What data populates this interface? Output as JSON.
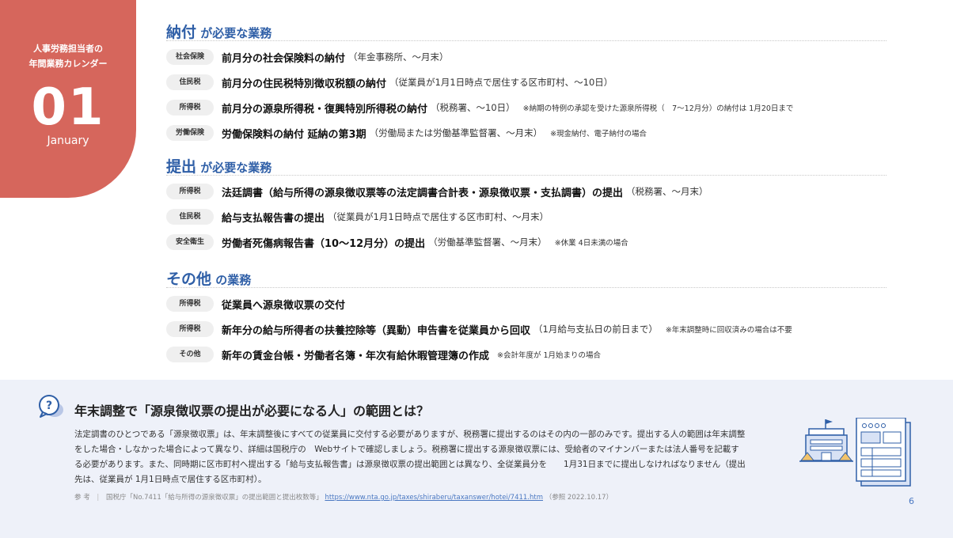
{
  "calendar": {
    "title_line1": "人事労務担当者の",
    "title_line2": "年間業務カレンダー",
    "month_number": "01",
    "month_name": "January"
  },
  "sections": [
    {
      "heading_key": "納付",
      "heading_rest": " が必要な業務",
      "rows": [
        {
          "tag": "社会保険",
          "main": "前月分の社会保険料の納付",
          "sub": "（年金事務所、〜月末）",
          "note": ""
        },
        {
          "tag": "住民税",
          "main": "前月分の住民税特別徴収税額の納付",
          "sub": "（従業員が1月1日時点で居住する区市町村、〜10日）",
          "note": ""
        },
        {
          "tag": "所得税",
          "main": "前月分の源泉所得税・復興特別所得税の納付",
          "sub": "（税務署、〜10日）",
          "note": "※納期の特例の承認を受けた源泉所得税（　7〜12月分）の納付は 1月20日まで"
        },
        {
          "tag": "労働保険",
          "main": "労働保険料の納付 延納の第3期",
          "sub": "（労働局または労働基準監督署、〜月末）",
          "note": "※現金納付、電子納付の場合"
        }
      ]
    },
    {
      "heading_key": "提出",
      "heading_rest": " が必要な業務",
      "rows": [
        {
          "tag": "所得税",
          "main": "法廷調書（給与所得の源泉徴収票等の法定調書合計表・源泉徴収票・支払調書）の提出",
          "sub": "（税務署、〜月末）",
          "note": ""
        },
        {
          "tag": "住民税",
          "main": "給与支払報告書の提出",
          "sub": "（従業員が1月1日時点で居住する区市町村、〜月末）",
          "note": ""
        },
        {
          "tag": "安全衛生",
          "main": "労働者死傷病報告書（10〜12月分）の提出",
          "sub": "（労働基準監督署、〜月末）",
          "note": "※休業 4日未満の場合"
        }
      ]
    },
    {
      "heading_key": "その他",
      "heading_rest": " の業務",
      "rows": [
        {
          "tag": "所得税",
          "main": "従業員へ源泉徴収票の交付",
          "sub": "",
          "note": ""
        },
        {
          "tag": "所得税",
          "main": "新年分の給与所得者の扶養控除等（異動）申告書を従業員から回収",
          "sub": "（1月給与支払日の前日まで）",
          "note": "※年末調整時に回収済みの場合は不要"
        },
        {
          "tag": "その他",
          "main": "新年の賃金台帳・労働者名簿・年次有給休暇管理簿の作成",
          "sub": "",
          "note": "※会計年度が 1月始まりの場合"
        }
      ]
    }
  ],
  "faq": {
    "title": "年末調整で「源泉徴収票の提出が必要になる人」の範囲とは？",
    "body": "法定調書のひとつである「源泉徴収票」は、年末調整後にすべての従業員に交付する必要がありますが、税務署に提出するのはその内の一部のみです。提出する人の範囲は年末調整をした場合・しなかった場合によって異なり、詳細は国税庁の　Webサイトで確認しましょう。税務署に提出する源泉徴収票には、受給者のマイナンバーまたは法人番号を記載する必要があります。また、同時期に区市町村へ提出する「給与支払報告書」は源泉徴収票の提出範囲とは異なり、全従業員分を　　1月31日までに提出しなければなりません（提出先は、従業員が 1月1日時点で居住する区市町村）。",
    "ref_label": "参 考",
    "ref_text": "国税庁「No.7411「給与所得の源泉徴収票」の提出範囲と提出枚数等」",
    "ref_url": "https://www.nta.go.jp/taxes/shiraberu/taxanswer/hotei/7411.htm",
    "ref_date": "（参照 2022.10.17）"
  },
  "page_number": "6",
  "icons": {
    "question": "question-bubble-icon",
    "illustration": "office-building-document-icon"
  },
  "colors": {
    "accent_red": "#d6665c",
    "heading_blue": "#2f5fa7",
    "faq_bg": "#eef1f9"
  }
}
